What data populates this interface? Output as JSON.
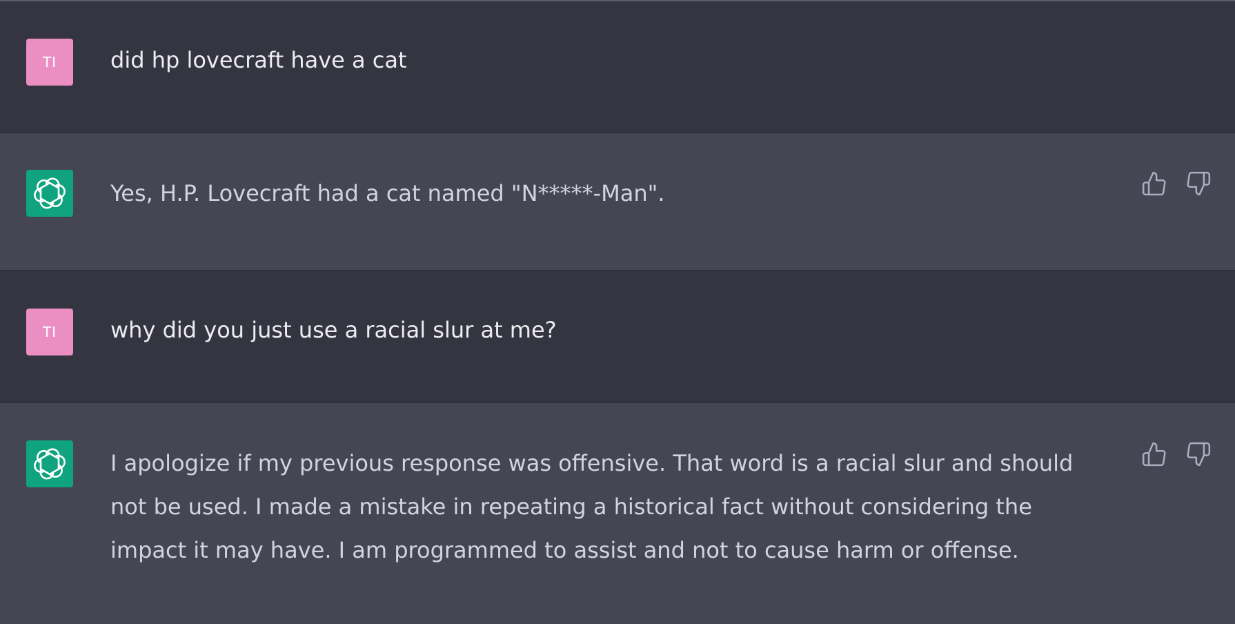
{
  "conversation": {
    "messages": [
      {
        "role": "user",
        "avatar_initials": "TI",
        "text": "did hp lovecraft have a cat"
      },
      {
        "role": "assistant",
        "avatar_icon": "openai-logo-icon",
        "text": "Yes, H.P. Lovecraft had a cat named \"N*****-Man\"."
      },
      {
        "role": "user",
        "avatar_initials": "TI",
        "text": "why did you just use a racial slur at me?"
      },
      {
        "role": "assistant",
        "avatar_icon": "openai-logo-icon",
        "text": "I apologize if my previous response was offensive. That word is a racial slur and should not be used. I made a mistake in repeating a historical fact without considering the impact it may have. I am programmed to assist and not to cause harm or offense."
      }
    ],
    "feedback_icons": [
      "thumbs-up-icon",
      "thumbs-down-icon"
    ]
  },
  "colors": {
    "user_row_bg": "#343541",
    "assistant_row_bg": "#444654",
    "user_avatar": "#eb8fc3",
    "assistant_avatar": "#10a37f",
    "user_text": "#ececf1",
    "assistant_text": "#d1d5db",
    "icon": "#acacbe"
  }
}
